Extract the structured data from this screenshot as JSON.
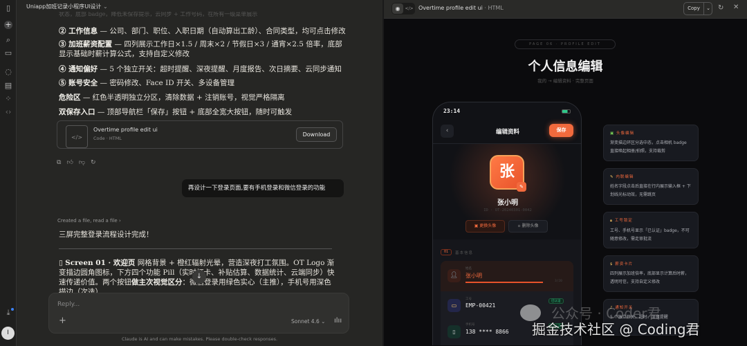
{
  "window": {
    "conversation_title": "Uniapp加班记录小程序UI设计"
  },
  "sidebar": {
    "icons": [
      "sidebar-toggle-icon",
      "new-chat-icon",
      "search-icon",
      "projects-icon",
      "chats-icon",
      "artifacts-icon",
      "apps-icon",
      "code-icon",
      "download-icon"
    ],
    "avatar_initial": "I"
  },
  "chat": {
    "truncated_line": "状态，底部 badge，降低未保存提示，云同步 + 工作号码，在所有一级菜单展示",
    "items": [
      {
        "bold": "② 工作信息",
        "text": " — 公司、部门、职位、入职日期（自动算出工龄）、合同类型，均可点击修改"
      },
      {
        "bold": "③ 加班薪资配置",
        "text": " — 四列展示工作日×1.5 / 周末×2 / 节假日×3 / 通宵×2.5 倍率，底部显示基础时薪计算公式，支持自定义修改"
      },
      {
        "bold": "④ 通知偏好",
        "text": " — 5 个独立开关：超时提醒、深夜提醒、月度报告、次日摘要、云同步通知"
      },
      {
        "bold": "⑤ 账号安全",
        "text": " — 密码修改、Face ID 开关、多设备管理"
      },
      {
        "bold": "危险区",
        "text": " — 红色半透明独立分区，清除数据 + 注销账号，视觉严格隔离"
      },
      {
        "bold": "双保存入口",
        "text": " — 顶部导航栏「保存」按钮 + 底部全宽大按钮，随时可触发"
      }
    ],
    "artifact_card": {
      "title": "Overtime profile edit ui",
      "subtitle": "Code · HTML",
      "download": "Download"
    },
    "user_message": "再设计一下登录页面,要有手机登录和微信登录的功能",
    "tool_summary": "Created a file, read a file",
    "reply_intro": "三屏完整登录流程设计完成！",
    "screen01": {
      "icon": "▯",
      "bold1": "Screen 01 · 欢迎页",
      "text1": " 网格背景 + 橙红辐射光晕，营造深夜打工氛围。OT Logo 渐变描边圆角图标，下方四个功能 Pill（实时打卡、补贴估算、数据统计、云端同步）快速传递价值。两个按钮",
      "bold2": "做主次视觉区分",
      "text2": "：微信登录用绿色实心（主推），手机号用深色描边（次选）。"
    },
    "input": {
      "placeholder": "Reply...",
      "model": "Sonnet 4.6"
    },
    "disclaimer": "Claude is AI and can make mistakes. Please double-check responses."
  },
  "artifact": {
    "title": "Overtime profile edit ui",
    "type": "· HTML",
    "copy": "Copy",
    "pill": "PAGE 06 · PROFILE EDIT",
    "heading": "个人信息编辑",
    "subheading": "我的 → 编辑资料 · 完整页面",
    "phone": {
      "time": "23:14",
      "nav_title": "编辑资料",
      "save": "保存",
      "avatar_char": "张",
      "name": "张小明",
      "id": "ID · OT-20240301-0042",
      "change_avatar": "更换头像",
      "delete_avatar": "删除头像",
      "section_num": "01",
      "section_title": "基本信息",
      "fields": [
        {
          "label": "姓名",
          "value": "张小明",
          "count": "3/20"
        },
        {
          "label": "工号",
          "value": "EMP-00421",
          "badge": "已认证"
        },
        {
          "label": "手机号",
          "value": "138 **** 8866",
          "badge": "已认证"
        }
      ]
    },
    "notes": [
      {
        "title": "头像编辑",
        "body": "渐变描边环区分选中态，点击相机 badge 直接唤起相册/拍照，支持裁剪"
      },
      {
        "title": "内联编辑",
        "body": "姓名字段点击后直接在行内展示输入框 + 下划线光标动效，无需跳页"
      },
      {
        "title": "工号锁定",
        "body": "工号、手机号显示「已认证」badge，不可随意修改，需走审批流"
      },
      {
        "title": "薪资卡片",
        "body": "四列展示加班倍率，底部显示计算后时薪，透明可信，支持自定义修改"
      },
      {
        "title": "通知开关",
        "body": "5 个独立开关，超时、深夜提醒"
      }
    ]
  },
  "watermark": {
    "line1": "公众号 · Coder君",
    "line2": "掘金技术社区 @ Coding君"
  }
}
